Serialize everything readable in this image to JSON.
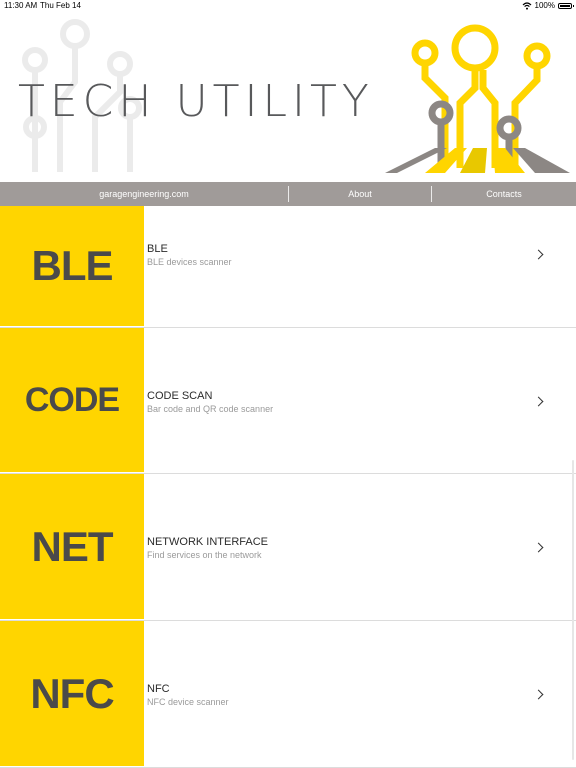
{
  "status_bar": {
    "time": "11:30 AM",
    "date": "Thu Feb 14",
    "battery": "100%"
  },
  "header": {
    "title": "TECH UTILITY"
  },
  "nav": {
    "items": [
      "garagengineering.com",
      "About",
      "Contacts"
    ]
  },
  "colors": {
    "accent": "#ffd500",
    "nav_bg": "#a09b99",
    "title_gray": "#58595b"
  },
  "list": [
    {
      "tile": "BLE",
      "title": "BLE",
      "subtitle": "BLE devices scanner"
    },
    {
      "tile": "CODE",
      "title": "CODE SCAN",
      "subtitle": "Bar code and QR code scanner"
    },
    {
      "tile": "NET",
      "title": "NETWORK INTERFACE",
      "subtitle": "Find services on the network"
    },
    {
      "tile": "NFC",
      "title": "NFC",
      "subtitle": "NFC device scanner"
    }
  ]
}
